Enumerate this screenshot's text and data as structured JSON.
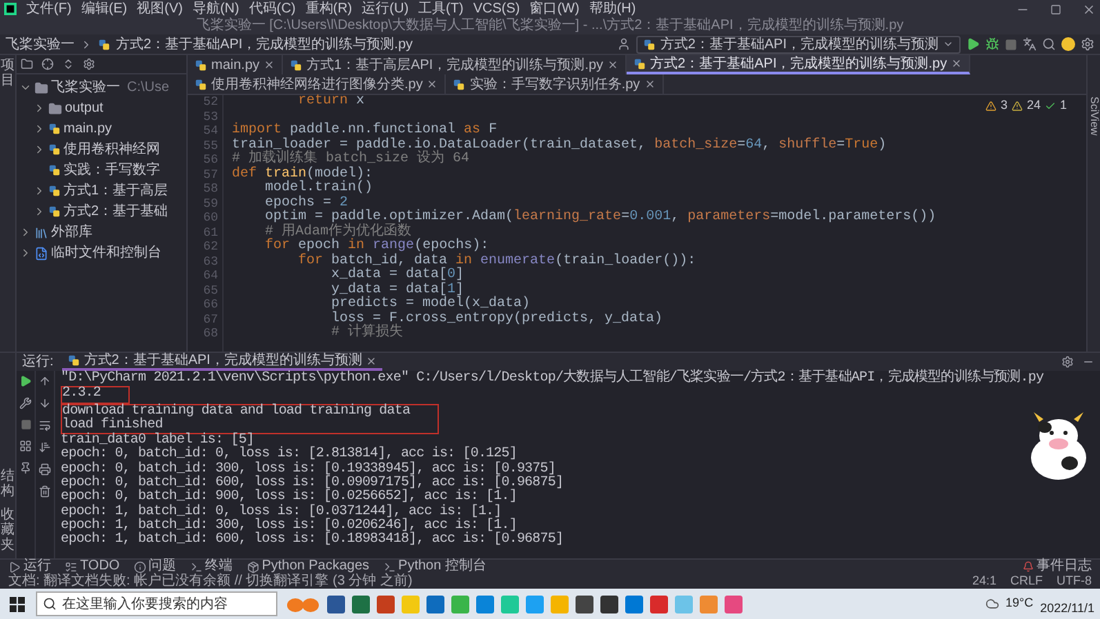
{
  "menu": [
    "文件(F)",
    "编辑(E)",
    "视图(V)",
    "导航(N)",
    "代码(C)",
    "重构(R)",
    "运行(U)",
    "工具(T)",
    "VCS(S)",
    "窗口(W)",
    "帮助(H)"
  ],
  "window": {
    "title": "飞桨实验一 [C:\\Users\\l\\Desktop\\大数据与人工智能\\飞桨实验一] - ...\\方式2：基于基础API，完成模型的训练与预测.py"
  },
  "breadcrumb": [
    "飞桨实验一",
    "方式2：基于基础API，完成模型的训练与预测.py"
  ],
  "run_config": "方式2：基于基础API，完成模型的训练与预测",
  "left_strip": {
    "top": [
      "项目"
    ],
    "bottom": [
      "结构",
      "收藏夹"
    ]
  },
  "right_strip": [
    "SciView"
  ],
  "project_tree": [
    {
      "label": "飞桨实验一",
      "path": "C:\\Use",
      "kind": "folder",
      "expanded": true,
      "children": [
        {
          "label": "output",
          "kind": "folder",
          "expanded": false
        },
        {
          "label": "main.py",
          "kind": "python",
          "expanded": false
        },
        {
          "label": "使用卷积神经网",
          "kind": "python",
          "expanded": false
        },
        {
          "label": "实践：手写数字",
          "kind": "python"
        },
        {
          "label": "方式1：基于高层",
          "kind": "python",
          "expanded": false
        },
        {
          "label": "方式2：基于基础",
          "kind": "python",
          "expanded": false
        }
      ]
    },
    {
      "label": "外部库",
      "kind": "library",
      "expanded": false
    },
    {
      "label": "临时文件和控制台",
      "kind": "scratch",
      "expanded": false
    }
  ],
  "editor_tabs": [
    {
      "label": "main.py",
      "selected": false
    },
    {
      "label": "方式1：基于高层API，完成模型的训练与预测.py",
      "selected": false
    },
    {
      "label": "方式2：基于基础API，完成模型的训练与预测.py",
      "selected": true
    },
    {
      "label": "使用卷积神经网络进行图像分类.py",
      "selected": false
    },
    {
      "label": "实验：手写数字识别任务.py",
      "selected": false
    }
  ],
  "inspections": {
    "warnings": "3",
    "weak_warnings": "24",
    "typos": "1"
  },
  "code": [
    {
      "number": "52",
      "tokens": [
        {
          "text": "        return",
          "kind": "keyword"
        },
        {
          "text": " x",
          "kind": "plain"
        }
      ]
    },
    {
      "number": "53"
    },
    {
      "number": "54",
      "tokens": [
        {
          "text": "import",
          "kind": "keyword"
        },
        {
          "text": " paddle.nn.functional ",
          "kind": "plain"
        },
        {
          "text": "as",
          "kind": "keyword"
        },
        {
          "text": " F",
          "kind": "plain"
        }
      ]
    },
    {
      "number": "55",
      "tokens": [
        {
          "text": "train_loader = paddle.io.DataLoader(train_dataset, ",
          "kind": "plain"
        },
        {
          "text": "batch_size",
          "kind": "param"
        },
        {
          "text": "=",
          "kind": "plain"
        },
        {
          "text": "64",
          "kind": "number"
        },
        {
          "text": ", ",
          "kind": "plain"
        },
        {
          "text": "shuffle",
          "kind": "param"
        },
        {
          "text": "=",
          "kind": "plain"
        },
        {
          "text": "True",
          "kind": "keyword"
        },
        {
          "text": ")",
          "kind": "plain"
        }
      ]
    },
    {
      "number": "56",
      "tokens": [
        {
          "text": "# 加载训练集 batch_size 设为 64",
          "kind": "comment"
        }
      ]
    },
    {
      "number": "57",
      "tokens": [
        {
          "text": "def ",
          "kind": "keyword"
        },
        {
          "text": "train",
          "kind": "function"
        },
        {
          "text": "(model):",
          "kind": "plain"
        }
      ]
    },
    {
      "number": "58",
      "tokens": [
        {
          "text": "    model.train()",
          "kind": "plain"
        }
      ]
    },
    {
      "number": "59",
      "tokens": [
        {
          "text": "    epochs = ",
          "kind": "plain"
        },
        {
          "text": "2",
          "kind": "number"
        }
      ]
    },
    {
      "number": "60",
      "tokens": [
        {
          "text": "    optim = paddle.optimizer.Adam(",
          "kind": "plain"
        },
        {
          "text": "learning_rate",
          "kind": "param"
        },
        {
          "text": "=",
          "kind": "plain"
        },
        {
          "text": "0.001",
          "kind": "number"
        },
        {
          "text": ", ",
          "kind": "plain"
        },
        {
          "text": "parameters",
          "kind": "param"
        },
        {
          "text": "=model.parameters())",
          "kind": "plain"
        }
      ]
    },
    {
      "number": "61",
      "tokens": [
        {
          "text": "    # 用Adam作为优化函数",
          "kind": "comment"
        }
      ]
    },
    {
      "number": "62",
      "tokens": [
        {
          "text": "    for",
          "kind": "keyword"
        },
        {
          "text": " epoch ",
          "kind": "plain"
        },
        {
          "text": "in",
          "kind": "keyword"
        },
        {
          "text": " range",
          "kind": "builtin"
        },
        {
          "text": "(epochs):",
          "kind": "plain"
        }
      ]
    },
    {
      "number": "63",
      "tokens": [
        {
          "text": "        for",
          "kind": "keyword"
        },
        {
          "text": " batch_id, data ",
          "kind": "plain"
        },
        {
          "text": "in",
          "kind": "keyword"
        },
        {
          "text": " enumerate",
          "kind": "builtin"
        },
        {
          "text": "(train_loader()):",
          "kind": "plain"
        }
      ]
    },
    {
      "number": "64",
      "tokens": [
        {
          "text": "            x_data = data[",
          "kind": "plain"
        },
        {
          "text": "0",
          "kind": "number"
        },
        {
          "text": "]",
          "kind": "plain"
        }
      ]
    },
    {
      "number": "65",
      "tokens": [
        {
          "text": "            y_data = data[",
          "kind": "plain"
        },
        {
          "text": "1",
          "kind": "number"
        },
        {
          "text": "]",
          "kind": "plain"
        }
      ]
    },
    {
      "number": "66",
      "tokens": [
        {
          "text": "            predicts = model(x_data)",
          "kind": "plain"
        }
      ]
    },
    {
      "number": "67",
      "tokens": [
        {
          "text": "            loss = F.cross_entropy(predicts, y_data)",
          "kind": "plain"
        }
      ]
    },
    {
      "number": "68",
      "tokens": [
        {
          "text": "            # 计算损失",
          "kind": "comment"
        }
      ]
    }
  ],
  "run_panel": {
    "label": "运行:",
    "tab": "方式2：基于基础API，完成模型的训练与预测"
  },
  "console": [
    {
      "boxed": false,
      "lines": [
        "\"D:\\PyCharm 2021.2.1\\venv\\Scripts\\python.exe\" C:/Users/l/Desktop/大数据与人工智能/飞桨实验一/方式2：基于基础API，完成模型的训练与预测.py"
      ]
    },
    {
      "boxed": true,
      "lines": [
        "2.3.2"
      ]
    },
    {
      "boxed": true,
      "lines": [
        "download training data and load training data",
        "load finished"
      ]
    },
    {
      "boxed": false,
      "lines": [
        "train_data0 label is: [5]",
        "epoch: 0, batch_id: 0, loss is: [2.813814], acc is: [0.125]",
        "epoch: 0, batch_id: 300, loss is: [0.19338945], acc is: [0.9375]",
        "epoch: 0, batch_id: 600, loss is: [0.09097175], acc is: [0.96875]",
        "epoch: 0, batch_id: 900, loss is: [0.0256652], acc is: [1.]",
        "epoch: 1, batch_id: 0, loss is: [0.0371244], acc is: [1.]",
        "epoch: 1, batch_id: 300, loss is: [0.0206246], acc is: [1.]",
        "epoch: 1, batch_id: 600, loss is: [0.18983418], acc is: [0.96875]"
      ]
    }
  ],
  "tool_tabs": [
    {
      "label": "运行",
      "kind": "run"
    },
    {
      "label": "TODO",
      "kind": "todo"
    },
    {
      "label": "问题",
      "kind": "problems"
    },
    {
      "label": "终端",
      "kind": "terminal"
    },
    {
      "label": "Python Packages",
      "kind": "packages"
    },
    {
      "label": "Python 控制台",
      "kind": "console"
    }
  ],
  "event_log": "事件日志",
  "status_bar": {
    "message": "文档: 翻译文档失败: 帐户已没有余额 // 切换翻译引擎 (3 分钟 之前)",
    "items": [
      "24:1",
      "CRLF",
      "UTF-8"
    ]
  },
  "taskbar": {
    "search_placeholder": "在这里输入你要搜索的内容",
    "weather": "19°C",
    "date": "2022/11/1"
  }
}
